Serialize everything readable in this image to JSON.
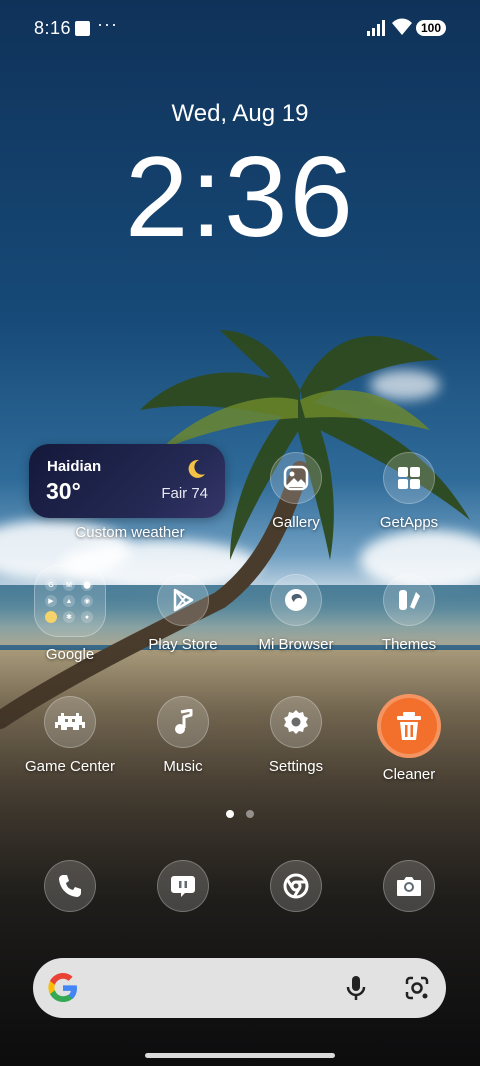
{
  "status_bar": {
    "time": "8:16",
    "dots": "···",
    "battery": "100"
  },
  "lockscreen": {
    "date": "Wed, Aug 19",
    "clock": "2:36"
  },
  "weather_widget": {
    "city": "Haidian",
    "temperature": "30°",
    "condition": "Fair 74",
    "label": "Custom weather"
  },
  "apps": {
    "gallery": "Gallery",
    "getapps": "GetApps",
    "google": "Google",
    "play_store": "Play Store",
    "mi_browser": "Mi Browser",
    "themes": "Themes",
    "game_center": "Game Center",
    "music": "Music",
    "settings": "Settings",
    "cleaner": "Cleaner"
  },
  "google_folder_minis": [
    "G",
    "M",
    "",
    "",
    "",
    "",
    "",
    "",
    ""
  ],
  "dock": [
    "phone-icon",
    "messages-icon",
    "chrome-icon",
    "camera-icon"
  ],
  "colors": {
    "cleaner_accent": "#f2702c",
    "weather_widget_bg": "#1c2046"
  },
  "page_indicator": {
    "pages": 2,
    "current": 1
  }
}
